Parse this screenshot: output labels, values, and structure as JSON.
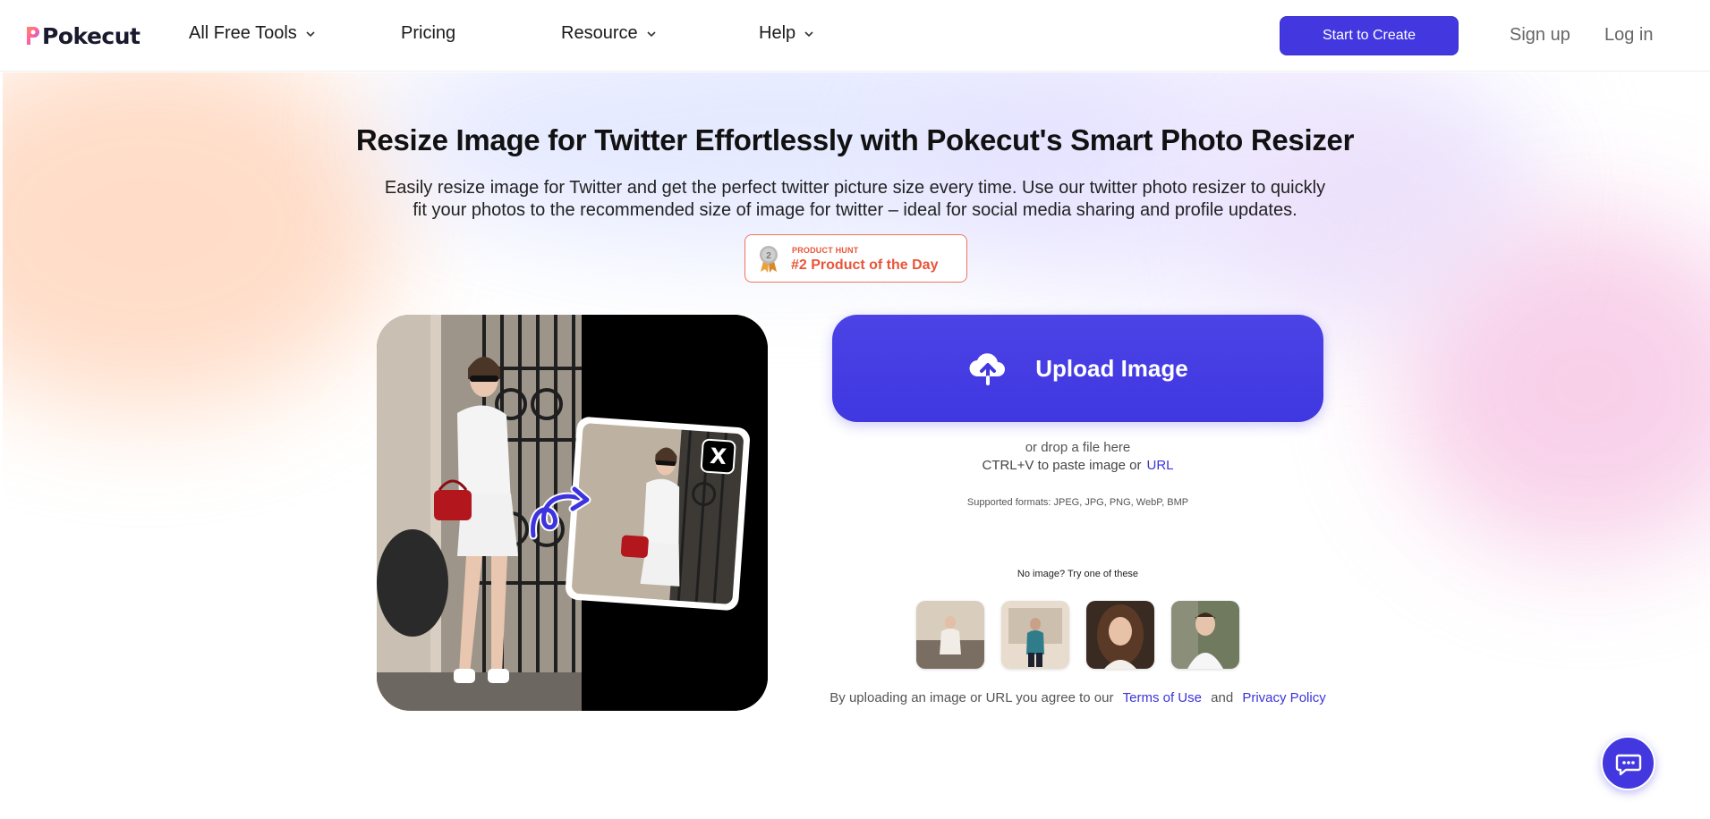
{
  "header": {
    "logo_text": "Pokecut",
    "nav": [
      {
        "label": "All Free Tools",
        "has_dropdown": true
      },
      {
        "label": "Pricing",
        "has_dropdown": false
      },
      {
        "label": "Resource",
        "has_dropdown": true
      },
      {
        "label": "Help",
        "has_dropdown": true
      }
    ],
    "cta_label": "Start to Create",
    "signup_label": "Sign up",
    "login_label": "Log in"
  },
  "hero": {
    "title": "Resize Image for Twitter Effortlessly with Pokecut's Smart Photo Resizer",
    "subtitle": "Easily resize image for Twitter and get the perfect twitter picture size every time. Use our twitter photo resizer to quickly fit your photos to the recommended size of image for twitter – ideal for social media sharing and profile updates.",
    "badge": {
      "rank": "2",
      "small": "PRODUCT HUNT",
      "big": "#2 Product of the Day"
    },
    "demo_badge_glyph": "X"
  },
  "upload": {
    "button_label": "Upload Image",
    "drop_hint": "or drop a file here",
    "paste_hint": "CTRL+V to paste image or",
    "url_link": "URL",
    "formats": "Supported formats: JPEG, JPG, PNG, WebP, BMP",
    "no_image": "No image? Try one of these",
    "agree_prefix": "By uploading an image or URL you agree to our",
    "terms_label": "Terms of Use",
    "and_text": "and",
    "privacy_label": "Privacy Policy"
  },
  "colors": {
    "brand": "#4338e0",
    "badge_accent": "#e8553a",
    "link": "#3b34d8"
  },
  "icons": {
    "upload": "cloud-upload-icon",
    "chat": "chat-bubble-icon",
    "chevron": "chevron-down-icon",
    "medal": "medal-icon"
  }
}
